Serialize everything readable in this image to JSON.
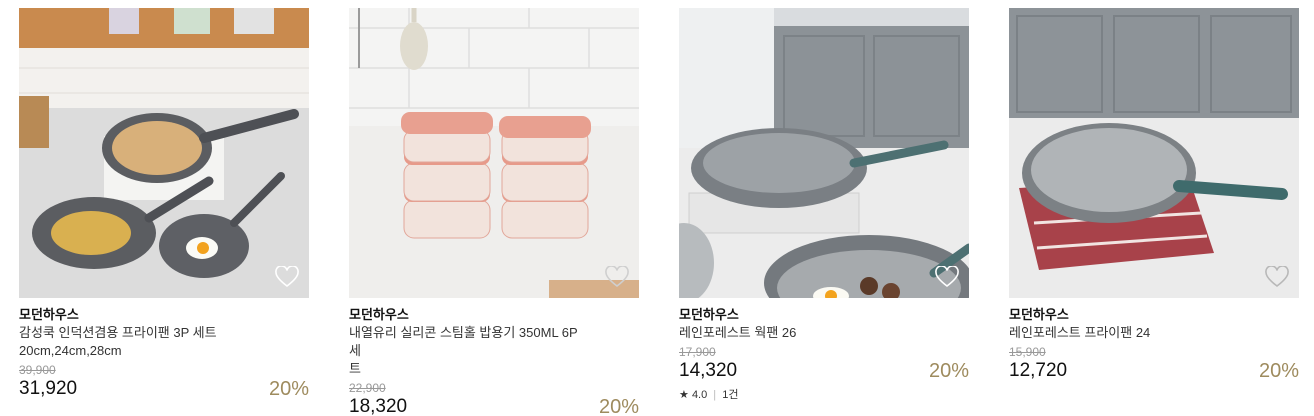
{
  "products": [
    {
      "brand": "모던하우스",
      "name_line1": "감성쿡 인덕션겸용 프라이팬 3P 세트",
      "name_line2": "20cm,24cm,28cm",
      "original_price": "39,900",
      "price": "31,920",
      "discount": "20%"
    },
    {
      "brand": "모던하우스",
      "name_line1": "내열유리 실리콘 스팀홀 밥용기 350ML 6P세",
      "name_line2": "트",
      "original_price": "22,900",
      "price": "18,320",
      "discount": "20%"
    },
    {
      "brand": "모던하우스",
      "name_line1": "레인포레스트 웍팬 26",
      "original_price": "17,900",
      "price": "14,320",
      "discount": "20%",
      "rating_star": "★",
      "rating": "4.0",
      "review_count": "1건"
    },
    {
      "brand": "모던하우스",
      "name_line1": "레인포레스트 프라이팬 24",
      "original_price": "15,900",
      "price": "12,720",
      "discount": "20%"
    }
  ],
  "colors": {
    "discount": "#9e8b5e",
    "original_price": "#999999",
    "heart_outline": "#ffffff"
  },
  "icons": {
    "wishlist": "heart-outline-icon",
    "rating": "star-icon"
  }
}
